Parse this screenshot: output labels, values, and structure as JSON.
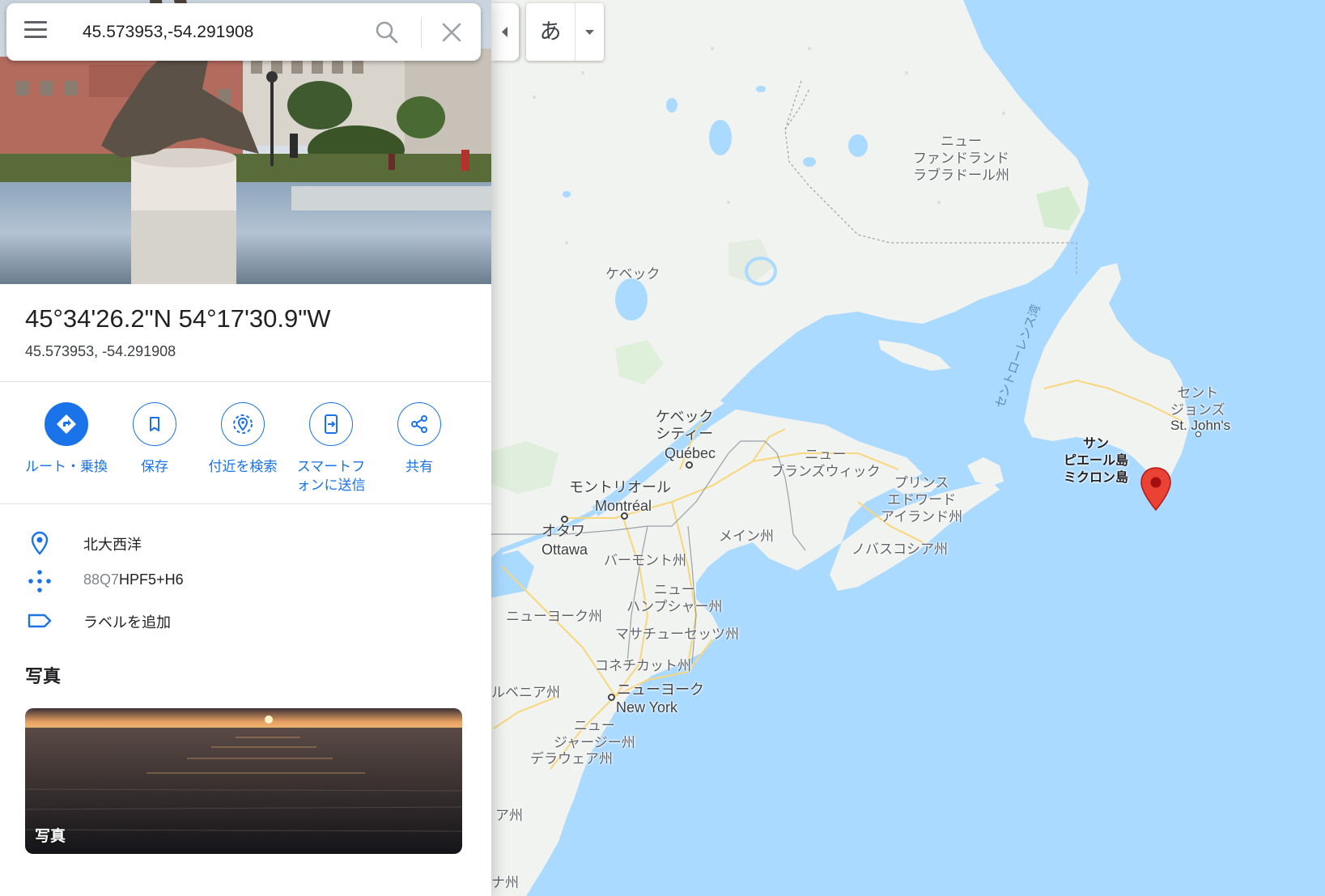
{
  "search": {
    "value": "45.573953,-54.291908"
  },
  "place": {
    "title": "45°34'26.2\"N 54°17'30.9\"W",
    "decimal": "45.573953, -54.291908"
  },
  "actions": [
    {
      "label": "ルート・乗換",
      "icon": "directions-icon"
    },
    {
      "label": "保存",
      "icon": "bookmark-icon"
    },
    {
      "label": "付近を検索",
      "icon": "nearby-icon"
    },
    {
      "label": "スマートフォンに送信",
      "icon": "send-to-phone-icon"
    },
    {
      "label": "共有",
      "icon": "share-icon"
    }
  ],
  "info": {
    "location": "北大西洋",
    "plus_code_prefix": "88Q7",
    "plus_code_suffix": "HPF5+H6",
    "add_label": "ラベルを追加"
  },
  "photos": {
    "heading": "写真",
    "card_label": "写真"
  },
  "ime": {
    "char": "あ"
  },
  "map_labels": {
    "newfoundland": "ニュー\nファンドランド\nラブラドール州",
    "quebec_prov": "ケベック",
    "gulf": "セントローレンス湾",
    "st_johns_jp": "セント\nジョンズ",
    "st_johns": "St. John's",
    "spm": "サン\nピエール島\nミクロン島",
    "quebec_city_jp": "ケベック\nシティー",
    "quebec_city": "Québec",
    "new_brunswick": "ニュー\nブランズウィック",
    "pei": "プリンス\nエドワード\nアイランド州",
    "montreal_jp": "モントリオール",
    "montreal": "Montréal",
    "ottawa_jp": "オタワ",
    "ottawa": "Ottawa",
    "maine": "メイン州",
    "nova_scotia": "ノバスコシア州",
    "vermont": "バーモント州",
    "new_hampshire": "ニュー\nハンプシャー州",
    "new_york_state": "ニューヨーク州",
    "massachusetts": "マサチューセッツ州",
    "connecticut": "コネチカット州",
    "new_york_city_jp": "ニューヨーク",
    "new_york_city": "New York",
    "pennsylvania": "ルベニア州",
    "new_jersey": "ニュー\nジャージー州",
    "delaware": "デラウェア州",
    "maryland": "ア州",
    "carolina": "ナ州"
  },
  "colors": {
    "accent": "#1a73e8",
    "water": "#aadaff",
    "land": "#f1f3f0",
    "pin": "#ea4335"
  }
}
